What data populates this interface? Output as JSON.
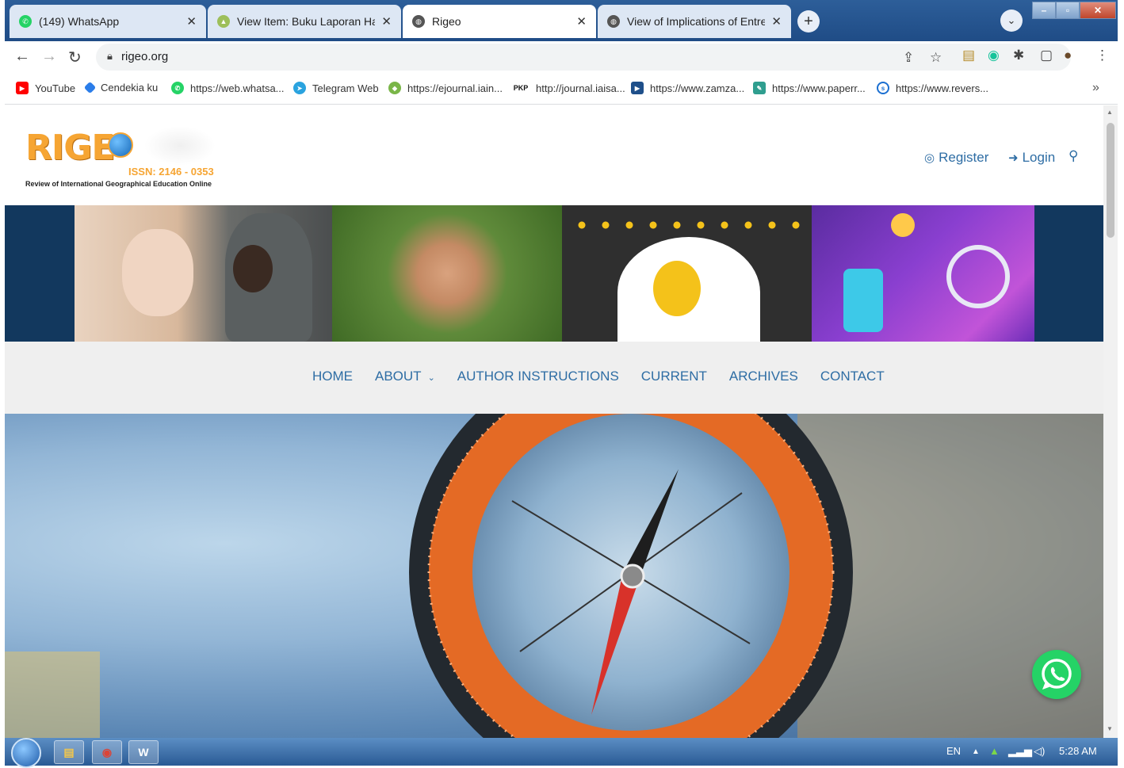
{
  "browser": {
    "tabs": [
      {
        "title": "(149) WhatsApp",
        "favicon": "whatsapp-icon",
        "active": false
      },
      {
        "title": "View Item: Buku Laporan Hasil Pe",
        "favicon": "repository-icon",
        "active": false
      },
      {
        "title": "Rigeo",
        "favicon": "globe-icon",
        "active": true
      },
      {
        "title": "View of Implications of Entrepren",
        "favicon": "globe-icon",
        "active": false
      }
    ],
    "new_tab_label": "+",
    "url": "rigeo.org",
    "bookmarks_overflow": "»",
    "bookmarks": [
      {
        "label": "YouTube",
        "icon": "youtube-icon",
        "color": "#ff0000"
      },
      {
        "label": "Cendekia ku",
        "icon": "diamond-icon",
        "color": "#2b7de9"
      },
      {
        "label": "https://web.whatsa...",
        "icon": "whatsapp-icon",
        "color": "#25d366"
      },
      {
        "label": "Telegram Web",
        "icon": "telegram-icon",
        "color": "#2aa3df"
      },
      {
        "label": "https://ejournal.iain...",
        "icon": "iain-logo-icon",
        "color": "#7ab648"
      },
      {
        "label": "http://journal.iaisa...",
        "icon": "pkp-icon",
        "badge": "PKP",
        "color": "#ffffff"
      },
      {
        "label": "https://www.zamza...",
        "icon": "zamzar-icon",
        "color": "#1f4f8a"
      },
      {
        "label": "https://www.paperr...",
        "icon": "feather-icon",
        "color": "#2f9e8f"
      },
      {
        "label": "https://www.revers...",
        "icon": "reverso-icon",
        "color": "#1b6fd1"
      }
    ]
  },
  "site": {
    "logo_text": "RIGE",
    "issn": "ISSN: 2146 - 0353",
    "tagline": "Review of International Geographical Education Online",
    "register_label": "Register",
    "login_label": "Login",
    "nav": [
      {
        "label": "HOME"
      },
      {
        "label": "ABOUT",
        "dropdown": true
      },
      {
        "label": "AUTHOR INSTRUCTIONS"
      },
      {
        "label": "CURRENT"
      },
      {
        "label": "ARCHIVES"
      },
      {
        "label": "CONTACT"
      }
    ],
    "banner_panels": [
      "children-photo",
      "joined-hands-photo",
      "lightbulb-head-illustration",
      "science-lab-illustration"
    ],
    "hero": "compass-on-map-photo",
    "accent_color": "#2e6da4",
    "banner_color": "#12385e"
  },
  "taskbar": {
    "apps": [
      "file-explorer-icon",
      "chrome-icon",
      "word-icon"
    ],
    "language": "EN",
    "time": "5:28 AM"
  }
}
